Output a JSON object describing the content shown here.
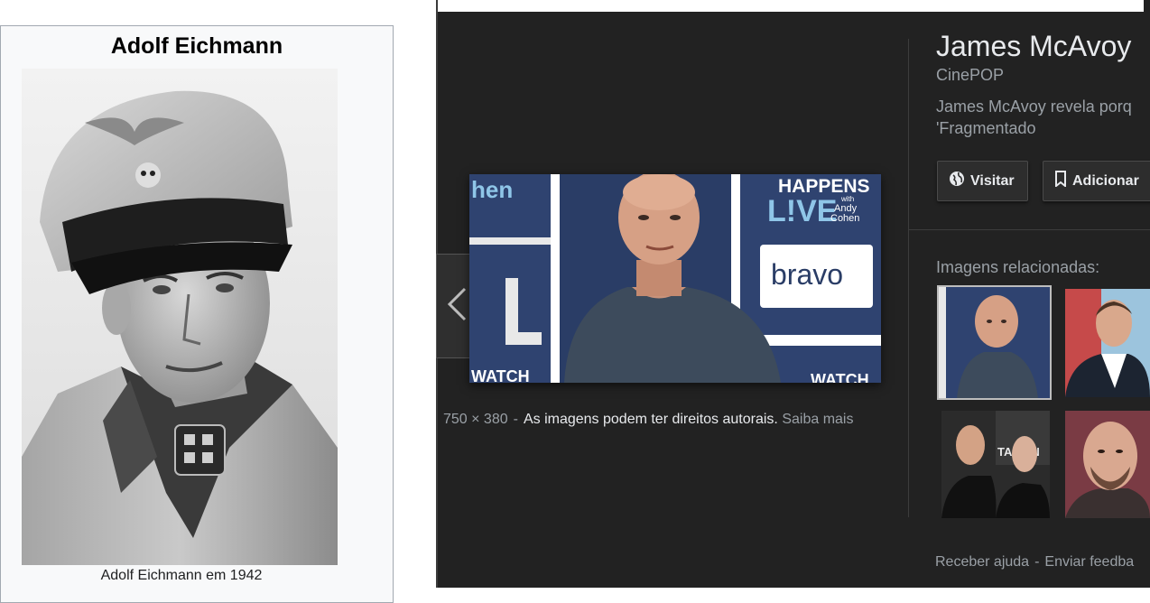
{
  "infobox": {
    "title": "Adolf Eichmann",
    "caption": "Adolf Eichmann em 1942"
  },
  "viewer": {
    "main_image": {
      "backdrop_text": {
        "happens": "HAPPENS",
        "live": "L!VE",
        "with_andy": "with",
        "andy_name": "Andy",
        "cohen": "Cohen",
        "bravo": "bravo",
        "hen": "hen",
        "watch": "WATCH"
      }
    },
    "dimensions": "750 × 380",
    "separator": "-",
    "rights_text": "As imagens podem ter direitos autorais.",
    "learn_more": "Saiba mais",
    "result_title": "James McAvoy",
    "source": "CinePOP",
    "description": "James McAvoy revela porq\n'Fragmentado",
    "visit_label": "Visitar",
    "add_label": "Adicionar",
    "related_label": "Imagens relacionadas:",
    "related_thumbs": [
      {
        "name": "related-thumb-1",
        "selected": true
      },
      {
        "name": "related-thumb-2",
        "selected": false
      },
      {
        "name": "related-thumb-3",
        "selected": false,
        "caption_fragment": "TARY N"
      },
      {
        "name": "related-thumb-4",
        "selected": false
      }
    ],
    "footer_help": "Receber ajuda",
    "footer_sep": "-",
    "footer_feedback": "Enviar feedba"
  },
  "colors": {
    "panel_bg": "#222222",
    "text_primary": "#e8eaed",
    "text_secondary": "#9aa0a6",
    "infobox_bg": "#f8f9fa",
    "backdrop_blue": "#2a3d66"
  },
  "icons": [
    "chevron-left-icon",
    "globe-icon",
    "bookmark-icon"
  ]
}
